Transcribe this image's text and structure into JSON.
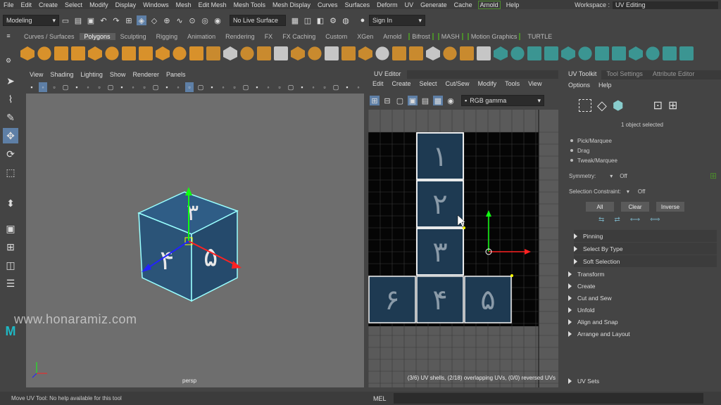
{
  "menubar": {
    "items": [
      "File",
      "Edit",
      "Create",
      "Select",
      "Modify",
      "Display",
      "Windows",
      "Mesh",
      "Edit Mesh",
      "Mesh Tools",
      "Mesh Display",
      "Curves",
      "Surfaces",
      "Deform",
      "UV",
      "Generate",
      "Cache",
      "Arnold",
      "Help"
    ],
    "workspace_label": "Workspace :",
    "workspace_value": "UV Editing"
  },
  "statusline": {
    "mode": "Modeling",
    "live_surface": "No Live Surface",
    "sign_in": "Sign In"
  },
  "shelf_tabs": [
    "Curves / Surfaces",
    "Polygons",
    "Sculpting",
    "Rigging",
    "Animation",
    "Rendering",
    "FX",
    "FX Caching",
    "Custom",
    "XGen",
    "Arnold",
    "Bifrost",
    "MASH",
    "Motion Graphics",
    "TURTLE"
  ],
  "viewport": {
    "menu": [
      "View",
      "Shading",
      "Lighting",
      "Show",
      "Renderer",
      "Panels"
    ],
    "camera_label": "persp",
    "cube_faces": {
      "top": "٣",
      "left": "۴",
      "right": "۵"
    }
  },
  "watermark": "www.honaramiz.com",
  "uv_editor": {
    "tab_title": "UV Editor",
    "menu": [
      "Edit",
      "Create",
      "Select",
      "Cut/Sew",
      "Modify",
      "Tools",
      "View"
    ],
    "color_mode": "RGB gamma",
    "shells": [
      "١",
      "٢",
      "٣",
      "۶",
      "۴",
      "۵"
    ],
    "status": "(3/6) UV shells, (2/18) overlapping UVs, (0/0) reversed UVs"
  },
  "right_panel": {
    "tabs": [
      "UV Toolkit",
      "Tool Settings",
      "Attribute Editor"
    ],
    "menu": [
      "Options",
      "Help"
    ],
    "selection_info": "1 object selected",
    "modes": [
      "Pick/Marquee",
      "Drag",
      "Tweak/Marquee"
    ],
    "symmetry_label": "Symmetry:",
    "symmetry_value": "Off",
    "constraint_label": "Selection Constraint:",
    "constraint_value": "Off",
    "buttons": [
      "All",
      "Clear",
      "Inverse"
    ],
    "sub_sections": [
      "Pinning",
      "Select By Type",
      "Soft Selection"
    ],
    "sections": [
      "Transform",
      "Create",
      "Cut and Sew",
      "Unfold",
      "Align and Snap",
      "Arrange and Layout"
    ],
    "footer_section": "UV Sets"
  },
  "bottombar": {
    "help_text": "Move UV Tool: No help available for this tool",
    "mel_label": "MEL"
  },
  "colors": {
    "accent": "#5e7fa6",
    "arnold_green": "#4c8c2c",
    "shelf_orange": "#e0962a",
    "shelf_teal": "#3aa3a0"
  }
}
